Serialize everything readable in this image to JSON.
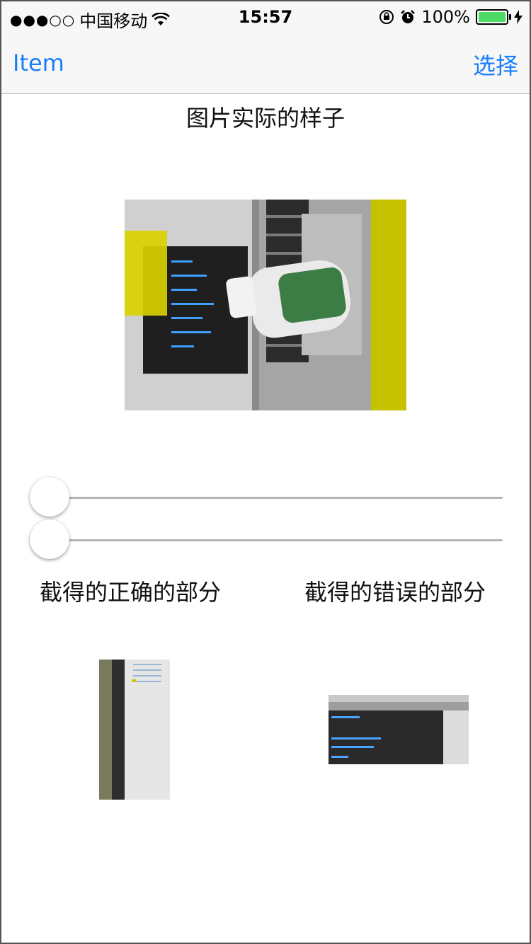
{
  "status_bar": {
    "signal": "●●●○○",
    "carrier": "中国移动",
    "time": "15:57",
    "battery": "100%",
    "battery_level": 1.0
  },
  "nav": {
    "left_label": "Item",
    "right_label": "选择"
  },
  "main": {
    "title": "图片实际的样子",
    "caption_correct": "截得的正确的部分",
    "caption_wrong": "截得的错误的部分"
  },
  "sliders": [
    {
      "value": 0
    },
    {
      "value": 0
    }
  ],
  "colors": {
    "accent": "#1a7dfa",
    "battery_fill": "#4cd964"
  }
}
